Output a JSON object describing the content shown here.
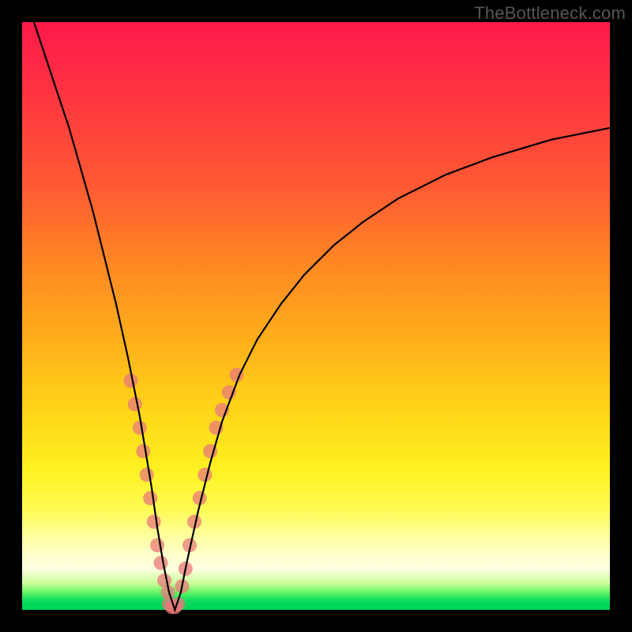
{
  "watermark": "TheBottleneck.com",
  "colors": {
    "frame": "#000000",
    "curve": "#000000",
    "scatter": "#e87a7a",
    "gradient_top": "#ff1a4b",
    "gradient_bottom": "#00d257"
  },
  "chart_data": {
    "type": "line",
    "title": "",
    "xlabel": "",
    "ylabel": "",
    "xlim": [
      0,
      100
    ],
    "ylim": [
      0,
      100
    ],
    "grid": false,
    "legend": false,
    "series": [
      {
        "name": "bottleneck-curve",
        "kind": "line",
        "x": [
          2,
          4,
          6,
          8,
          10,
          12,
          14,
          16,
          18,
          20,
          22,
          23,
          24,
          25,
          26,
          27,
          28,
          30,
          32,
          34,
          37,
          40,
          44,
          48,
          53,
          58,
          64,
          72,
          80,
          90,
          100
        ],
        "y": [
          100,
          94,
          88,
          82,
          75,
          68,
          60,
          52,
          43,
          33,
          21,
          14,
          8,
          3,
          0,
          3,
          8,
          17,
          25,
          32,
          40,
          46,
          52,
          57,
          62,
          66,
          70,
          74,
          77,
          80,
          82
        ]
      },
      {
        "name": "left-arm-scatter",
        "kind": "scatter",
        "x": [
          18.5,
          19.2,
          20.0,
          20.6,
          21.2,
          21.8,
          22.4,
          23.0,
          23.6,
          24.2,
          24.8
        ],
        "y": [
          39,
          35,
          31,
          27,
          23,
          19,
          15,
          11,
          8,
          5,
          3
        ]
      },
      {
        "name": "right-arm-scatter",
        "kind": "scatter",
        "x": [
          27.2,
          27.8,
          28.5,
          29.3,
          30.2,
          31.1,
          32.0,
          33.0,
          34.0,
          35.2,
          36.5
        ],
        "y": [
          4,
          7,
          11,
          15,
          19,
          23,
          27,
          31,
          34,
          37,
          40
        ]
      },
      {
        "name": "bottom-scatter",
        "kind": "scatter",
        "x": [
          25.0,
          25.5,
          26.0,
          26.5
        ],
        "y": [
          1,
          0.5,
          0.5,
          1
        ]
      }
    ],
    "annotations": [
      {
        "text": "TheBottleneck.com",
        "position": "top-right"
      }
    ]
  }
}
